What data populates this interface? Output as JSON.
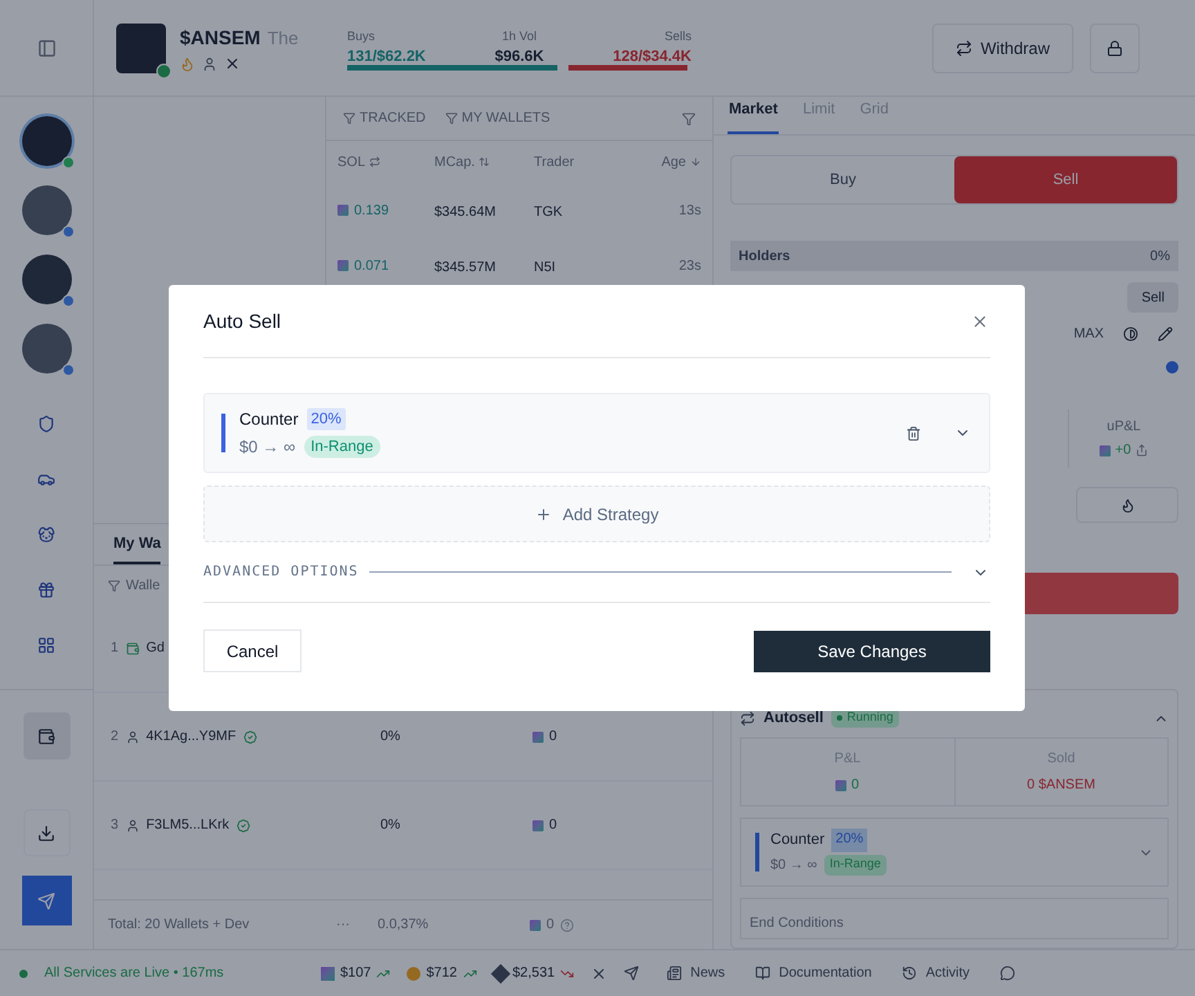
{
  "rail": {
    "avatars": [
      {
        "online": true
      },
      {
        "online": false
      },
      {
        "online": false
      },
      {
        "online": false
      }
    ],
    "buttons": [
      {
        "selected": false
      },
      {
        "selected": false
      },
      {
        "selected": false
      },
      {
        "selected": false
      },
      {
        "selected": false
      },
      {
        "selected": true
      },
      {
        "selected": false
      }
    ]
  },
  "token": {
    "symbol": "$ANSEM",
    "name": "The",
    "stats": [
      {
        "kind": "buys",
        "label": "Buys",
        "value": "131/$62.2K"
      },
      {
        "kind": "volume",
        "label": "1h Vol",
        "value": "$96.6K"
      },
      {
        "kind": "sells",
        "label": "Sells",
        "value": "128/$34.4K"
      }
    ],
    "ratio": {
      "level": 0.65
    }
  },
  "header_buttons": {
    "withdraw": "Withdraw"
  },
  "trades": {
    "filters": [
      "TRACKED",
      "MY WALLETS"
    ],
    "columns": [
      "SOL",
      "MCap.",
      "Trader",
      "Age"
    ],
    "rows": [
      {
        "sol": "0.139",
        "mcap": "$345.64M",
        "trader": "TGK",
        "age": "13s"
      },
      {
        "sol": "0.071",
        "mcap": "$345.57M",
        "trader": "N5I",
        "age": "23s"
      }
    ]
  },
  "wallets": {
    "tab": "My Wa",
    "filter": "Walle",
    "rows": [
      {
        "kind": "main",
        "index": "1",
        "name": "Gd"
      },
      {
        "kind": "sub",
        "index": "2",
        "name": "4K1Ag...Y9MF",
        "holding": "0%",
        "sol": "0"
      },
      {
        "kind": "sub",
        "index": "3",
        "name": "F3LM5...LKrk",
        "holding": "0%",
        "sol": "0"
      }
    ],
    "total": {
      "label": "Total: 20 Wallets + Dev",
      "dots": "···",
      "holding": "0.0,37%",
      "sol": "0"
    }
  },
  "trade_panel": {
    "tabs": [
      {
        "label": "Market",
        "selected": true
      },
      {
        "label": "Limit",
        "selected": false
      },
      {
        "label": "Grid",
        "selected": false
      }
    ],
    "sides": [
      {
        "label": "Buy",
        "selected": false
      },
      {
        "label": "Sell",
        "selected": true
      }
    ],
    "holders": {
      "label": "Holders",
      "value": "0%"
    },
    "sell_chip": "Sell",
    "max": "MAX",
    "upnl": {
      "label": "uP&L",
      "value": "+0"
    },
    "autosell": {
      "label": "Autosell",
      "status": "Running",
      "expanded": true,
      "pnl": {
        "label": "P&L",
        "value": "0"
      },
      "sold": {
        "label": "Sold",
        "value": "0 $ANSEM"
      },
      "strategy": {
        "name": "Counter",
        "percent": "20%",
        "range": "$0 → ∞",
        "status": "In-Range"
      },
      "end_label": "End Conditions"
    }
  },
  "status_bar": {
    "services": "All Services are Live • 167ms",
    "tickers": [
      {
        "kind": "sol",
        "price": "$107",
        "rising": true
      },
      {
        "kind": "bnb",
        "price": "$712",
        "rising": true
      },
      {
        "kind": "eth",
        "price": "$2,531",
        "rising": false
      }
    ],
    "links": [
      "News",
      "Documentation",
      "Activity"
    ]
  },
  "modal": {
    "title": "Auto Sell",
    "strategies": [
      {
        "name": "Counter",
        "percent": "20%",
        "range": "$0 → ∞",
        "status": "In-Range",
        "expanded": false
      }
    ],
    "add_label": "Add Strategy",
    "advanced": {
      "label": "ADVANCED OPTIONS",
      "expanded": false
    },
    "cancel": "Cancel",
    "save": "Save Changes"
  }
}
